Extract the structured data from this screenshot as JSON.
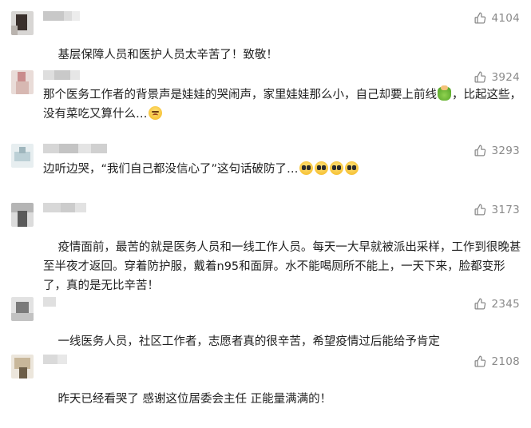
{
  "colors": {
    "text": "#1f1f1f",
    "meta": "#8a8a8a",
    "background": "#ffffff"
  },
  "like_icon": "thumbs-up-outline-icon",
  "comments": [
    {
      "likes": "4104",
      "text": "基层保障人员和医护人员太辛苦了！致敬！",
      "emojis": []
    },
    {
      "likes": "3924",
      "text_a": "那个医务工作者的背景声是娃娃的哭闹声，家里娃娃那么小，自己却要上前线",
      "text_b": "，比起这些，没有菜吃又算什么…",
      "emojis": [
        "strong-arm-emoji",
        "sad-face-emoji"
      ]
    },
    {
      "likes": "3293",
      "text": "边听边哭，“我们自己都没信心了”这句话破防了…",
      "emojis": [
        "crying-face-emoji",
        "crying-face-emoji",
        "crying-face-emoji",
        "crying-face-emoji"
      ]
    },
    {
      "likes": "3173",
      "text": "疫情面前，最苦的就是医务人员和一线工作人员。每天一大早就被派出采样，工作到很晚甚至半夜才返回。穿着防护服，戴着n95和面屏。水不能喝厕所不能上，一天下来，脸都变形了，真的是无比辛苦！",
      "emojis": []
    },
    {
      "likes": "2345",
      "text": "一线医务人员，社区工作者，志愿者真的很辛苦，希望疫情过后能给予肯定",
      "emojis": []
    },
    {
      "likes": "2108",
      "text": "昨天已经看哭了 感谢这位居委会主任 正能量满满的！",
      "emojis": []
    }
  ]
}
